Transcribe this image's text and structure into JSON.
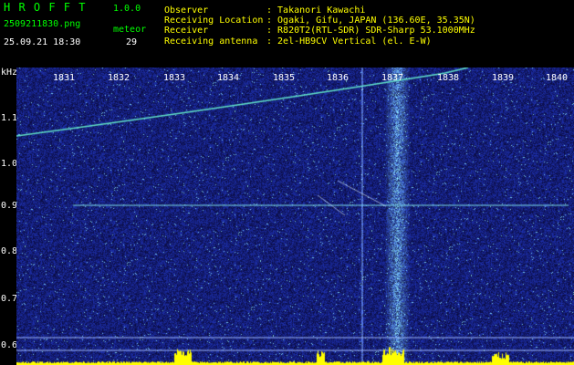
{
  "app": {
    "title": "H R O F F T",
    "version": "1.0.0"
  },
  "file": {
    "name": "2509211830.png",
    "datetime": "25.09.21 18:30"
  },
  "meteor": {
    "label": "meteor",
    "count": "29"
  },
  "info": [
    {
      "key": "Observer",
      "value": ": Takanori Kawachi"
    },
    {
      "key": "Receiving Location",
      "value": ": Ogaki, Gifu, JAPAN (136.60E, 35.35N)"
    },
    {
      "key": "Receiver",
      "value": ": R820T2(RTL-SDR) SDR-Sharp 53.1000MHz"
    },
    {
      "key": "Receiving antenna",
      "value": ": 2el-HB9CV Vertical (el. E-W)"
    }
  ],
  "axes": {
    "y_unit": "kHz",
    "x_ticks": [
      "1831",
      "1832",
      "1833",
      "1834",
      "1835",
      "1836",
      "1837",
      "1838",
      "1839",
      "1840"
    ],
    "y_ticks": [
      "1.1",
      "1.0",
      "0.9",
      "0.8",
      "0.7",
      "0.6"
    ]
  },
  "colors": {
    "green": "#00ff00",
    "yellow": "#ffff00",
    "spectrum_bg": "#0c1a7a",
    "signal": "#58d8e8"
  }
}
